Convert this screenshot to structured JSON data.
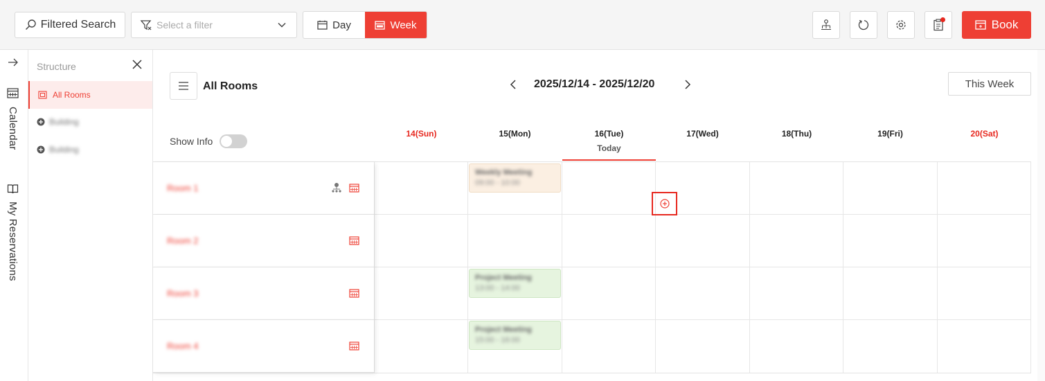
{
  "toolbar": {
    "filtered_search": "Filtered Search",
    "filter_placeholder": "Select a filter",
    "day": "Day",
    "week": "Week",
    "book": "Book",
    "icons": [
      "org-structure-icon",
      "refresh-icon",
      "settings-icon",
      "clipboard-icon"
    ],
    "accent": "#ee3f34"
  },
  "rail": {
    "calendar": "Calendar",
    "reservations": "My Reservations"
  },
  "structure": {
    "header": "Structure",
    "all_rooms": "All Rooms",
    "nodes": [
      "Building",
      "Building"
    ]
  },
  "main": {
    "title": "All Rooms",
    "date_range": "2025/12/14 - 2025/12/20",
    "this_week": "This Week",
    "show_info": "Show Info",
    "today_label": "Today",
    "days": [
      "14(Sun)",
      "15(Mon)",
      "16(Tue)",
      "17(Wed)",
      "18(Thu)",
      "19(Fri)",
      "20(Sat)"
    ],
    "rooms": [
      "Room 1",
      "Room 2",
      "Room 3",
      "Room 4"
    ],
    "bookings": [
      {
        "title": "Weekly Meeting",
        "sub": "09:00 - 10:00"
      },
      {
        "title": "Project Meeting",
        "sub": "13:00 - 14:00"
      },
      {
        "title": "Project Meeting",
        "sub": "15:00 - 16:00"
      }
    ]
  }
}
